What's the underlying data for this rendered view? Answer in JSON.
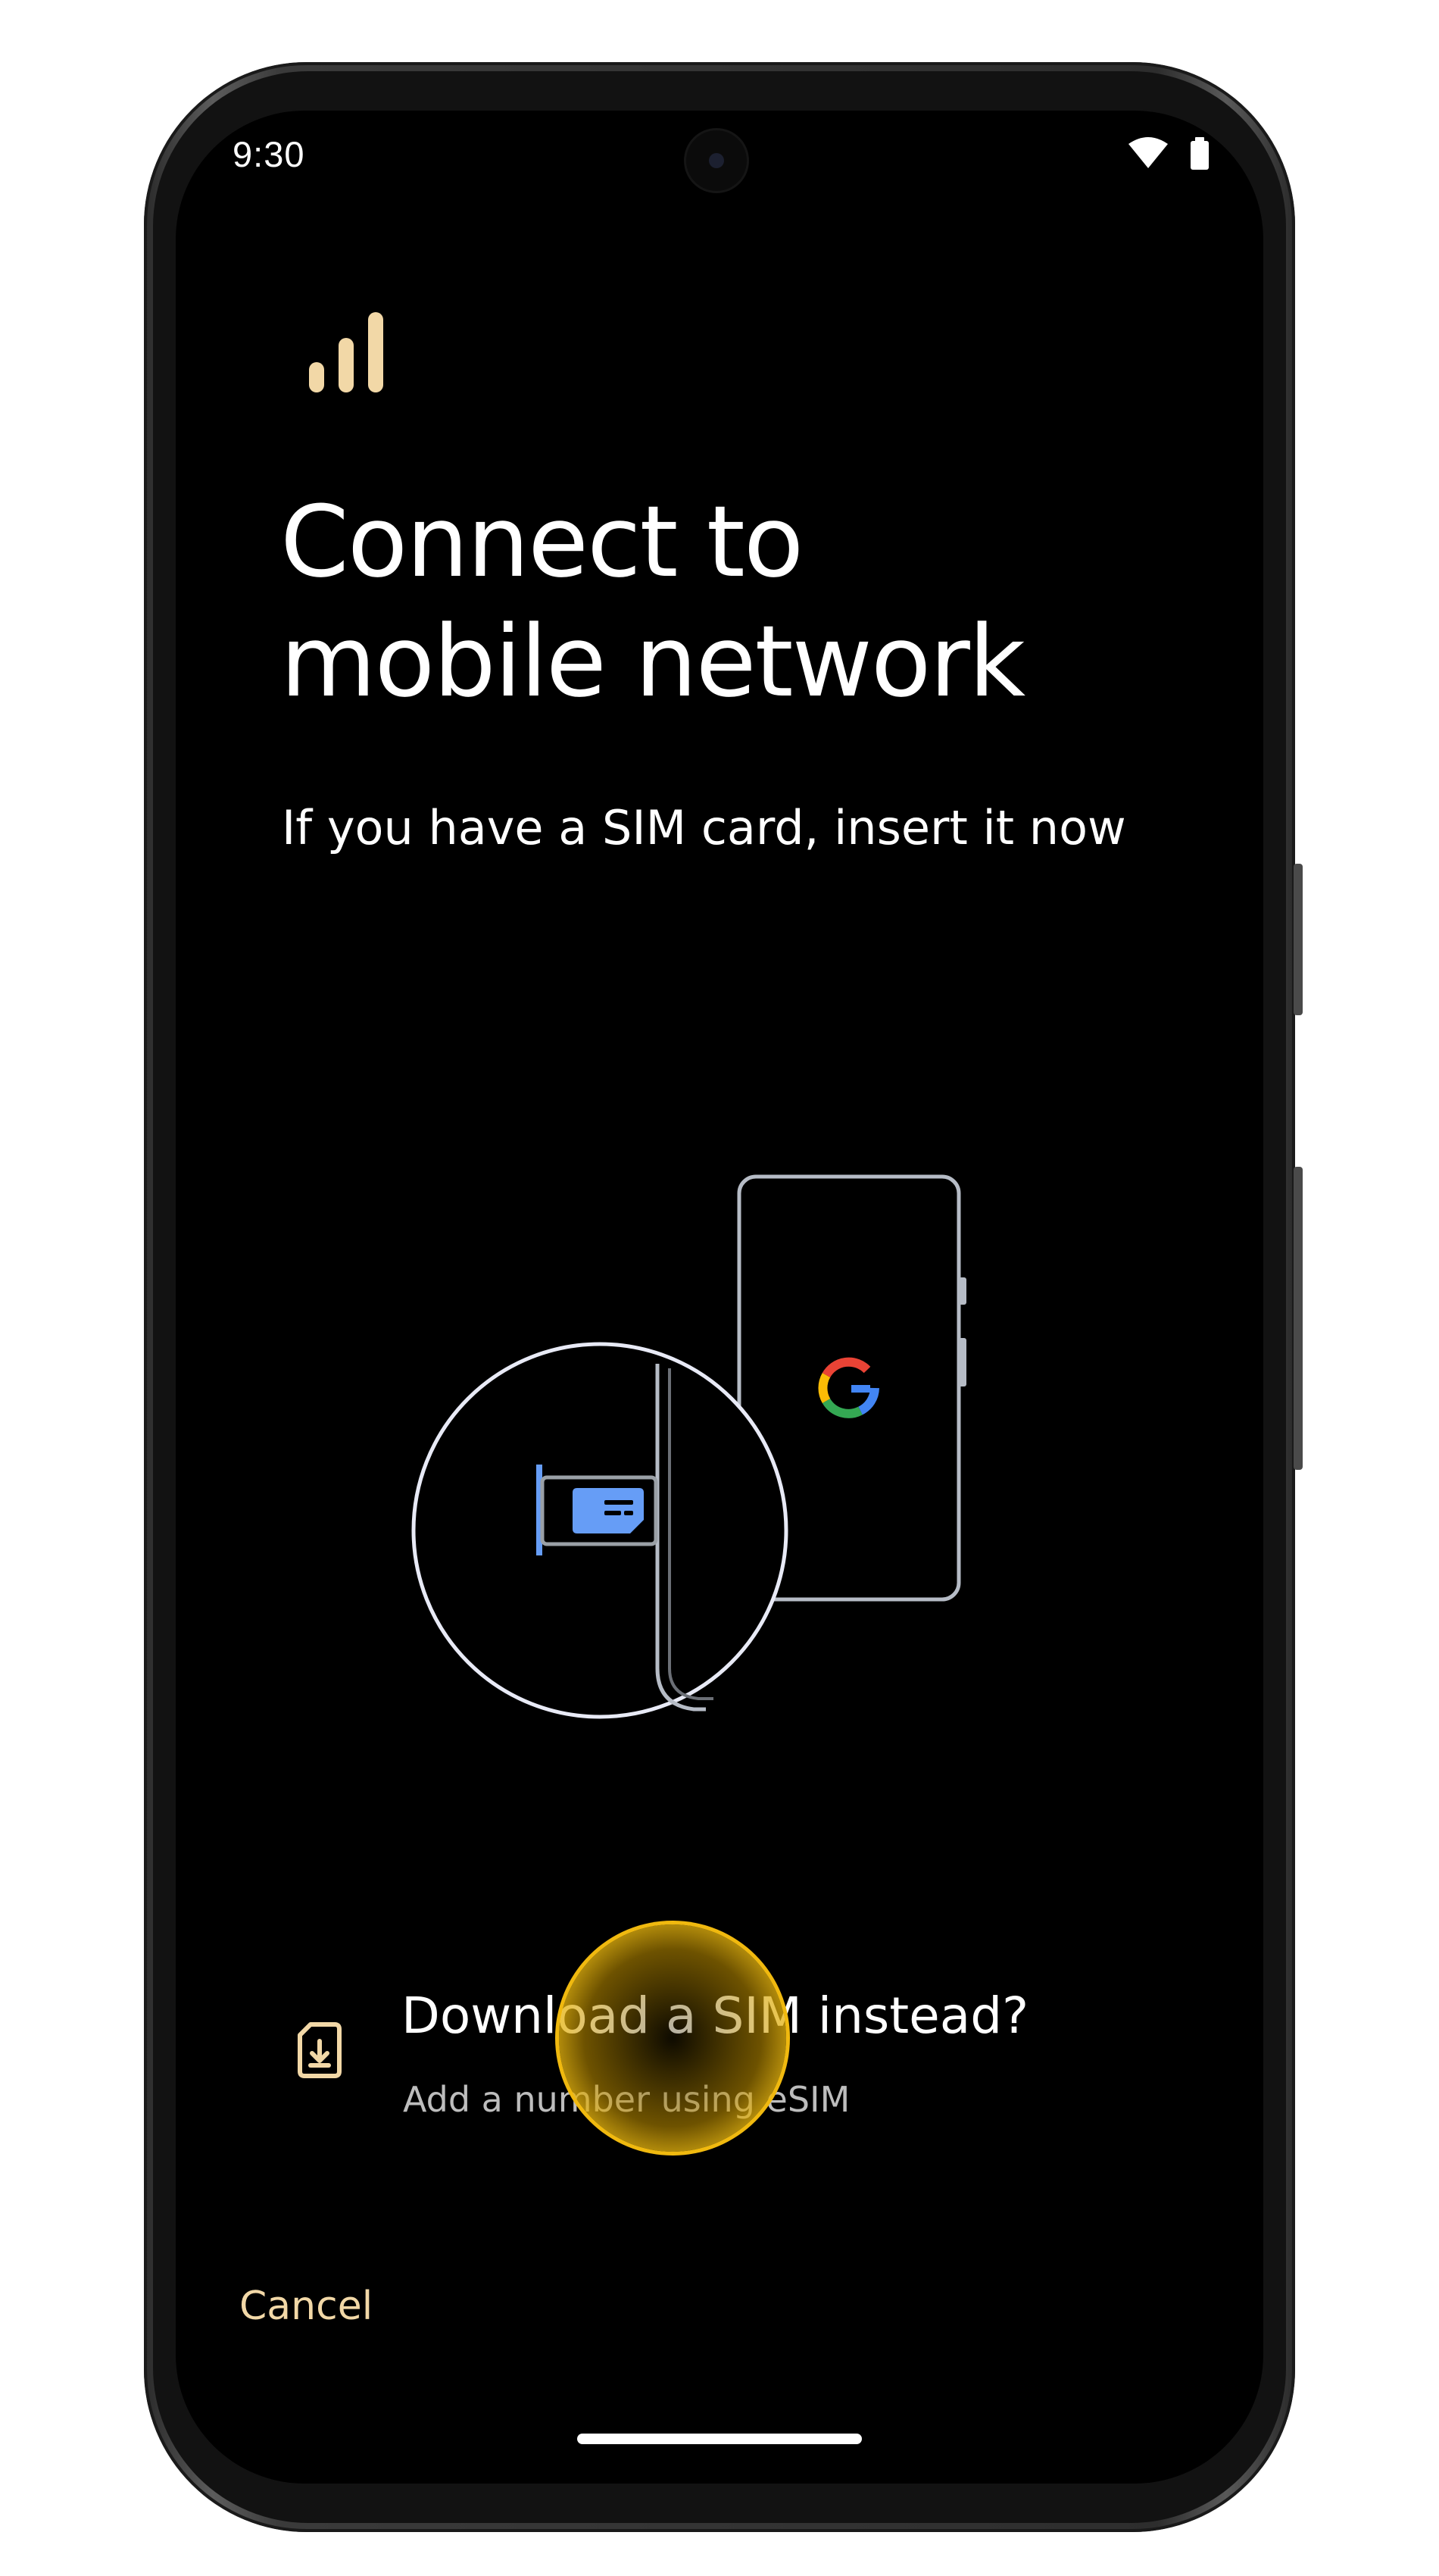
{
  "status_bar": {
    "time": "9:30",
    "icons": [
      "wifi-icon",
      "battery-icon"
    ]
  },
  "header": {
    "icon": "signal-bars-icon",
    "title": "Connect to mobile network",
    "subtitle": "If you have a SIM card, insert it now"
  },
  "illustration": {
    "description_icons": [
      "phone-outline-icon",
      "google-logo-icon",
      "sim-tray-icon",
      "sim-card-icon"
    ]
  },
  "esim_option": {
    "icon": "download-sim-icon",
    "title": "Download a SIM instead?",
    "subtitle": "Add a number using eSIM"
  },
  "footer": {
    "cancel_label": "Cancel"
  },
  "colors": {
    "accent": "#F2D8A7",
    "sim_blue": "#669DF6",
    "tap_highlight": "#F3C21A",
    "background": "#000000"
  }
}
